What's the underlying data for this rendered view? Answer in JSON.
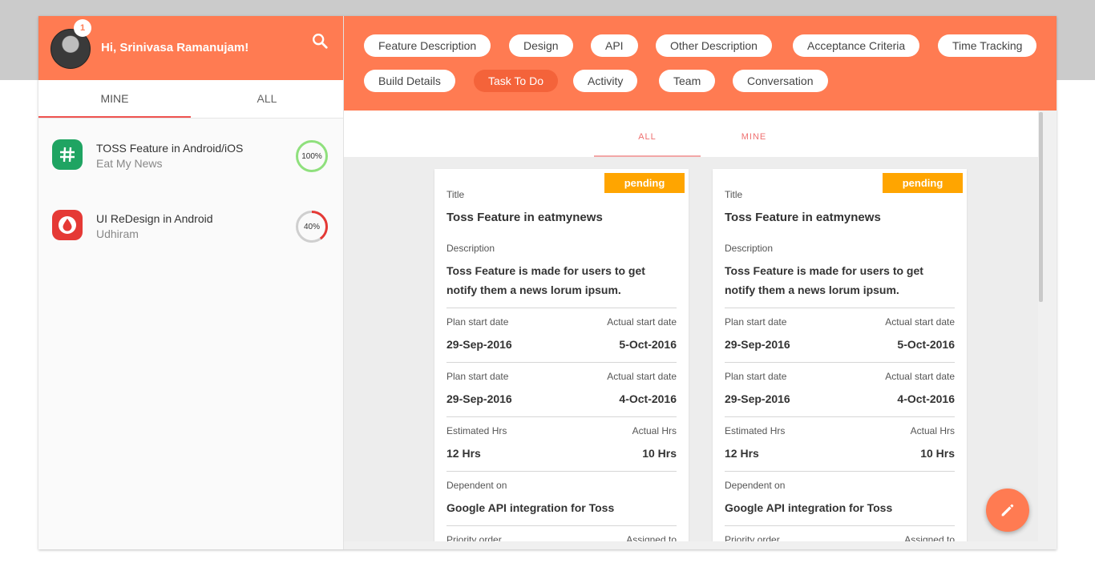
{
  "user": {
    "greeting": "Hi, Srinivasa Ramanujam!",
    "notification_count": "1"
  },
  "left_tabs": {
    "mine": "MINE",
    "all": "ALL"
  },
  "projects": [
    {
      "title": "TOSS Feature in Android/iOS",
      "subtitle": "Eat My News",
      "progress_label": "100%",
      "progress": 1.0,
      "icon": "hashtag-app-icon",
      "color": "#1fa462",
      "ring_color": "#8fe07d"
    },
    {
      "title": "UI ReDesign in Android",
      "subtitle": "Udhiram",
      "progress_label": "40%",
      "progress": 0.4,
      "icon": "blood-drop-app-icon",
      "color": "#e53935",
      "ring_color": "#e53935"
    }
  ],
  "section_tabs": [
    "Feature Description",
    "Design",
    "API",
    "Other Description",
    "Acceptance Criteria",
    "Time Tracking",
    "Build Details",
    "Task To Do",
    "Activity",
    "Team",
    "Conversation"
  ],
  "active_section": "Task To Do",
  "task_tabs": {
    "all": "ALL",
    "mine": "MINE"
  },
  "cards": [
    {
      "status": "pending",
      "title_label": "Title",
      "title": "Toss Feature in eatmynews",
      "description_label": "Description",
      "description": "Toss Feature is made for users to get notify them a news lorum ipsum.",
      "plan_label_1": "Plan start date",
      "plan_value_1": "29-Sep-2016",
      "actual_label_1": "Actual start date",
      "actual_value_1": "5-Oct-2016",
      "plan_label_2": "Plan start date",
      "plan_value_2": "29-Sep-2016",
      "actual_label_2": "Actual start date",
      "actual_value_2": "4-Oct-2016",
      "est_label": "Estimated Hrs",
      "est_value": "12 Hrs",
      "act_hrs_label": "Actual Hrs",
      "act_hrs_value": "10 Hrs",
      "dependent_label": "Dependent on",
      "dependent_value": "Google API integration for Toss",
      "priority_label": "Priority order",
      "assigned_label": "Assigned to"
    },
    {
      "status": "pending",
      "title_label": "Title",
      "title": "Toss Feature in eatmynews",
      "description_label": "Description",
      "description": "Toss Feature is made for users to get notify them a news lorum ipsum.",
      "plan_label_1": "Plan start date",
      "plan_value_1": "29-Sep-2016",
      "actual_label_1": "Actual start date",
      "actual_value_1": "5-Oct-2016",
      "plan_label_2": "Plan start date",
      "plan_value_2": "29-Sep-2016",
      "actual_label_2": "Actual start date",
      "actual_value_2": "4-Oct-2016",
      "est_label": "Estimated Hrs",
      "est_value": "12 Hrs",
      "act_hrs_label": "Actual Hrs",
      "act_hrs_value": "10 Hrs",
      "dependent_label": "Dependent on",
      "dependent_value": "Google API integration for Toss",
      "priority_label": "Priority order",
      "assigned_label": "Assigned to"
    }
  ],
  "colors": {
    "brand": "#ff7b52",
    "active_chip": "#f4633a",
    "pending": "#ffa500",
    "tab_accent": "#ef5350"
  },
  "icons": {
    "search": "search-icon",
    "edit": "pencil-icon"
  }
}
